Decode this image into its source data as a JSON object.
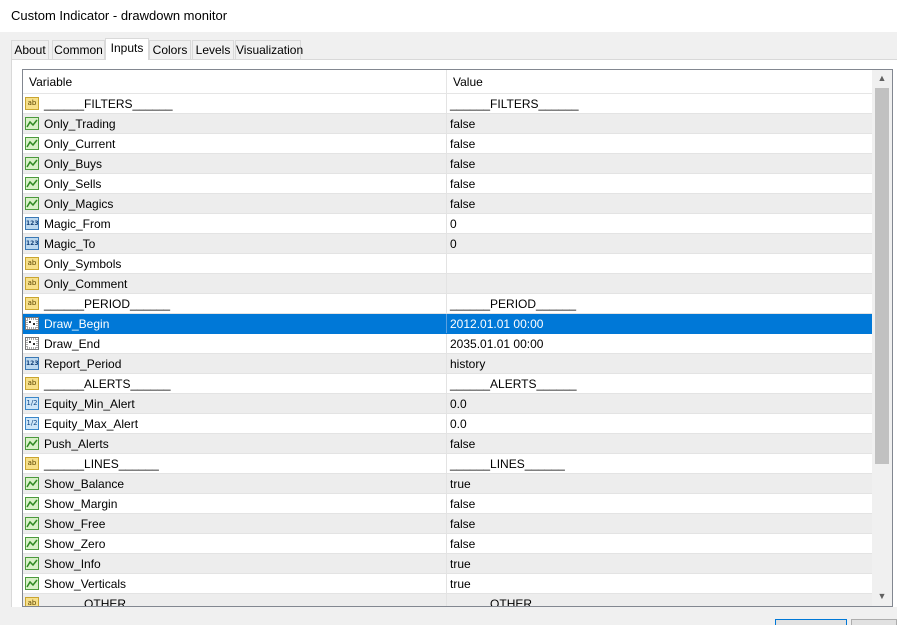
{
  "window": {
    "title": "Custom Indicator - drawdown monitor"
  },
  "tabs": [
    {
      "label": "About"
    },
    {
      "label": "Common"
    },
    {
      "label": "Inputs",
      "active": true
    },
    {
      "label": "Colors"
    },
    {
      "label": "Levels"
    },
    {
      "label": "Visualization"
    }
  ],
  "grid": {
    "headers": {
      "variable": "Variable",
      "value": "Value"
    },
    "rows": [
      {
        "type": "string",
        "icon": "string-icon",
        "variable": "______FILTERS______",
        "value": "______FILTERS______"
      },
      {
        "type": "bool",
        "icon": "bool-icon",
        "variable": "Only_Trading",
        "value": "false"
      },
      {
        "type": "bool",
        "icon": "bool-icon",
        "variable": "Only_Current",
        "value": "false"
      },
      {
        "type": "bool",
        "icon": "bool-icon",
        "variable": "Only_Buys",
        "value": "false"
      },
      {
        "type": "bool",
        "icon": "bool-icon",
        "variable": "Only_Sells",
        "value": "false"
      },
      {
        "type": "bool",
        "icon": "bool-icon",
        "variable": "Only_Magics",
        "value": "false"
      },
      {
        "type": "int",
        "icon": "integer-icon",
        "variable": "Magic_From",
        "value": "0"
      },
      {
        "type": "int",
        "icon": "integer-icon",
        "variable": "Magic_To",
        "value": "0"
      },
      {
        "type": "string",
        "icon": "string-icon",
        "variable": "Only_Symbols",
        "value": ""
      },
      {
        "type": "string",
        "icon": "string-icon",
        "variable": "Only_Comment",
        "value": ""
      },
      {
        "type": "string",
        "icon": "string-icon",
        "variable": "______PERIOD______",
        "value": "______PERIOD______"
      },
      {
        "type": "date",
        "icon": "datetime-icon",
        "variable": "Draw_Begin",
        "value": "2012.01.01 00:00",
        "selected": true
      },
      {
        "type": "date",
        "icon": "datetime-icon",
        "variable": "Draw_End",
        "value": "2035.01.01 00:00"
      },
      {
        "type": "int",
        "icon": "integer-icon",
        "variable": "Report_Period",
        "value": "history"
      },
      {
        "type": "string",
        "icon": "string-icon",
        "variable": "______ALERTS______",
        "value": "______ALERTS______"
      },
      {
        "type": "double",
        "icon": "double-icon",
        "variable": "Equity_Min_Alert",
        "value": "0.0"
      },
      {
        "type": "double",
        "icon": "double-icon",
        "variable": "Equity_Max_Alert",
        "value": "0.0"
      },
      {
        "type": "bool",
        "icon": "bool-icon",
        "variable": "Push_Alerts",
        "value": "false"
      },
      {
        "type": "string",
        "icon": "string-icon",
        "variable": "______LINES______",
        "value": "______LINES______"
      },
      {
        "type": "bool",
        "icon": "bool-icon",
        "variable": "Show_Balance",
        "value": "true"
      },
      {
        "type": "bool",
        "icon": "bool-icon",
        "variable": "Show_Margin",
        "value": "false"
      },
      {
        "type": "bool",
        "icon": "bool-icon",
        "variable": "Show_Free",
        "value": "false"
      },
      {
        "type": "bool",
        "icon": "bool-icon",
        "variable": "Show_Zero",
        "value": "false"
      },
      {
        "type": "bool",
        "icon": "bool-icon",
        "variable": "Show_Info",
        "value": "true"
      },
      {
        "type": "bool",
        "icon": "bool-icon",
        "variable": "Show_Verticals",
        "value": "true"
      },
      {
        "type": "string",
        "icon": "string-icon",
        "variable": "______OTHER______",
        "value": "______OTHER______"
      }
    ]
  },
  "icon_glyphs": {
    "string": "ab",
    "int": "123",
    "double": "1/2"
  },
  "colors": {
    "selection": "#0078d7",
    "alt_row": "#ededed"
  }
}
